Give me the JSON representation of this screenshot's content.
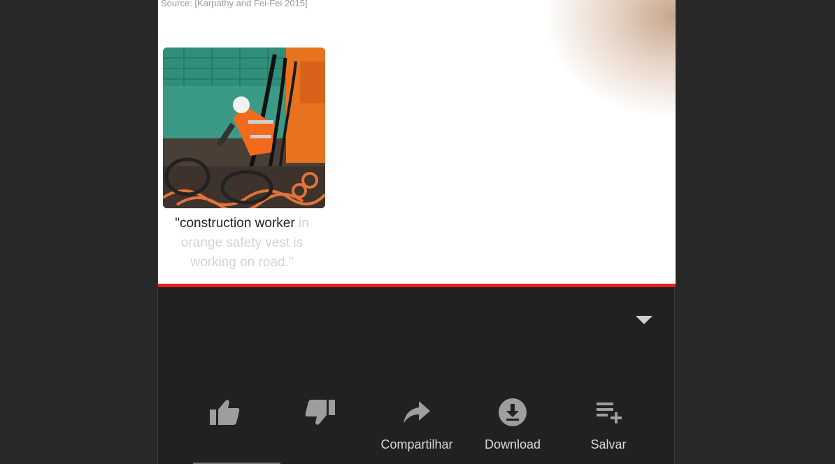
{
  "video": {
    "source_text": "Source: [Karpathy and Fei-Fei 2015]",
    "caption_line1": "\"construction worker",
    "caption_line1_faded": " in",
    "caption_line2": "orange safety vest is",
    "caption_line3": "working on road.\"",
    "progress_percent": 100
  },
  "actions": {
    "like_icon": "thumbs-up-icon",
    "dislike_icon": "thumbs-down-icon",
    "share_label": "Compartilhar",
    "download_label": "Download",
    "save_label": "Salvar"
  },
  "colors": {
    "progress": "#e52020",
    "background": "#212121"
  }
}
